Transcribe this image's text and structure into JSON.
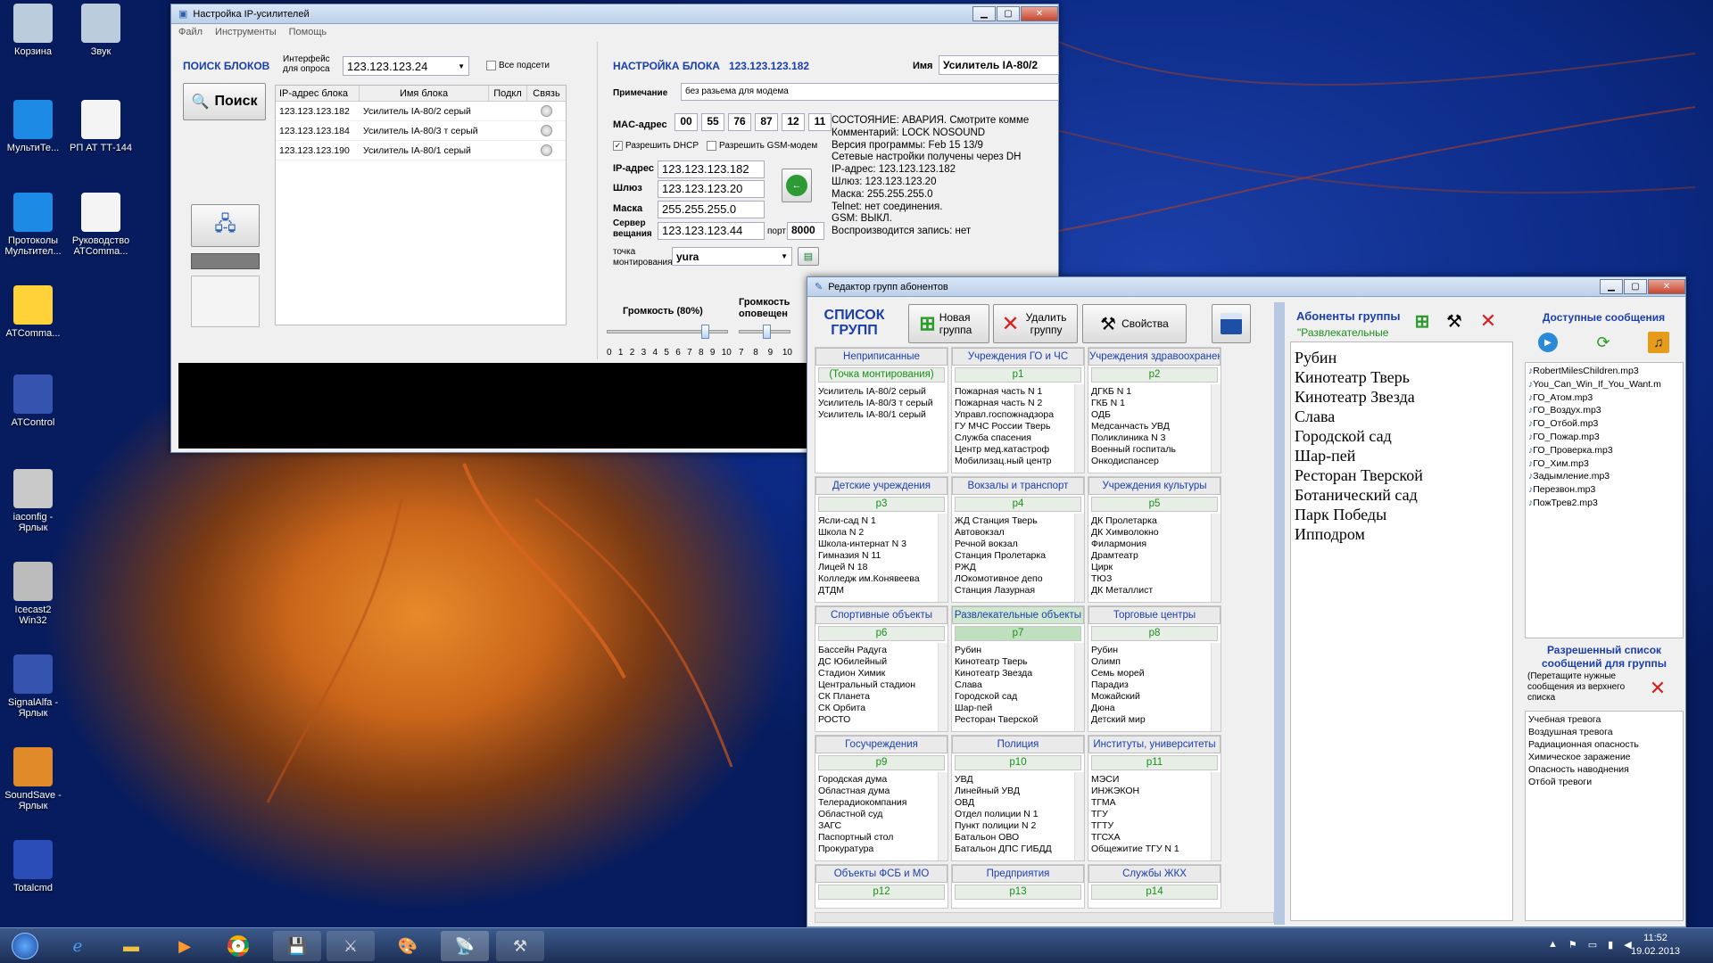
{
  "desktop": {
    "icons": [
      {
        "label": "Корзина",
        "name": "recycle-bin-icon"
      },
      {
        "label": "Звук",
        "name": "speaker-icon"
      },
      {
        "label": "МультиТе...",
        "name": "multite-app-icon"
      },
      {
        "label": "РП АТ ТТ-144",
        "name": "document-icon"
      },
      {
        "label": "Протоколы Мультител...",
        "name": "protocols-app-icon"
      },
      {
        "label": "Руководство ATComma...",
        "name": "document-icon"
      },
      {
        "label": "ATComma...",
        "name": "atcommander-icon"
      },
      {
        "label": "ATControl",
        "name": "atcontrol-icon"
      },
      {
        "label": "iaconfig - Ярлык",
        "name": "tools-icon"
      },
      {
        "label": "Icecast2 Win32",
        "name": "icecast-icon"
      },
      {
        "label": "SignalAlfa - Ярлык",
        "name": "signalalfa-icon"
      },
      {
        "label": "SoundSave - Ярлык",
        "name": "soundsave-icon"
      },
      {
        "label": "Totalcmd",
        "name": "totalcmd-icon"
      }
    ]
  },
  "amp_window": {
    "title": "Настройка IP-усилителей",
    "menu": [
      "Файл",
      "Инструменты",
      "Помощь"
    ],
    "search_heading": "ПОИСК БЛОКОВ",
    "iface_label": "Интерфейс для опроса",
    "iface_value": "123.123.123.24",
    "all_subnets": "Все подсети",
    "search_button": "Поиск",
    "table_headers": [
      "IP-адрес блока",
      "Имя блока",
      "Подкл",
      "Связь"
    ],
    "table_rows": [
      {
        "ip": "123.123.123.182",
        "name": "Усилитель IA-80/2 серый"
      },
      {
        "ip": "123.123.123.184",
        "name": "Усилитель IA-80/3 т серый"
      },
      {
        "ip": "123.123.123.190",
        "name": "Усилитель IA-80/1 серый"
      }
    ],
    "setup_heading": "НАСТРОЙКА БЛОКА",
    "setup_ip": "123.123.123.182",
    "name_label": "Имя",
    "name_value": "Усилитель IA-80/2",
    "note_label": "Примечание",
    "note_value": "без разьема для модема",
    "mac_label": "MAC-адрес",
    "mac": [
      "00",
      "55",
      "76",
      "87",
      "12",
      "11"
    ],
    "dhcp": "Разрешить DHCP",
    "gsm": "Разрешить GSM-модем",
    "ip_label": "IP-адрес",
    "ip_value": "123.123.123.182",
    "gw_label": "Шлюз",
    "gw_value": "123.123.123.20",
    "mask_label": "Маска",
    "mask_value": "255.255.255.0",
    "srv_label": "Сервер вещания",
    "srv_value": "123.123.123.44",
    "port_label": "порт",
    "port_value": "8000",
    "mount_label": "точка монтирования",
    "mount_value": "yura",
    "status_lines": [
      "СОСТОЯНИЕ: АВАРИЯ. Смотрите комме",
      "Комментарий: LOCK NOSOUND",
      "Версия программы: Feb 15 13/9",
      "Сетевые настройки получены через DH",
      "IP-адрес: 123.123.123.182",
      "Шлюз:     123.123.123.20",
      "Маска:     255.255.255.0",
      "Telnet:     нет соединения.",
      "GSM: ВЫКЛ.",
      "Воспроизводится запись: нет"
    ],
    "volume_label": "Громкость (80%)",
    "volume2_label": "Громкость оповещен",
    "volume_level": 0.8,
    "scale": [
      "0",
      "1",
      "2",
      "3",
      "4",
      "5",
      "6",
      "7",
      "8",
      "9",
      "10"
    ],
    "scale2": [
      "7",
      "8",
      "9",
      "10"
    ]
  },
  "group_window": {
    "title": "Редактор групп абонентов",
    "list_title": "СПИСОК ГРУПП",
    "new_group": "Новая группа",
    "delete_group": "Удалить группу",
    "properties": "Свойства",
    "groups": [
      {
        "name": "Неприписанные",
        "p": "(Точка монтирования)",
        "items": [
          "Усилитель IA-80/2 серый",
          "Усилитель IA-80/3 т серый",
          "Усилитель IA-80/1 серый"
        ]
      },
      {
        "name": "Учреждения ГО и ЧС",
        "p": "p1",
        "items": [
          "Пожарная часть N 1",
          "Пожарная часть N 2",
          "Управл.госпожнадзора",
          "ГУ МЧС России Тверь",
          "Служба спасения",
          "Центр мед.катастроф",
          "Мобилизац.ный центр"
        ]
      },
      {
        "name": "Учреждения здравоохранения",
        "p": "p2",
        "items": [
          "ДГКБ N 1",
          "ГКБ N 1",
          "ОДБ",
          "Медсанчасть УВД",
          "Поликлиника N 3",
          "Военный госпиталь",
          "Онкодиспансер"
        ]
      },
      {
        "name": "Детские учреждения",
        "p": "p3",
        "items": [
          "Ясли-сад N 1",
          "Школа N 2",
          "Школа-интернат N 3",
          "Гимназия N 11",
          "Лицей N 18",
          "Колледж им.Конявеева",
          "ДТДМ"
        ]
      },
      {
        "name": "Вокзалы и транспорт",
        "p": "p4",
        "items": [
          "ЖД Станция Тверь",
          "Автовокзал",
          "Речной вокзал",
          "Станция Пролетарка",
          "РЖД",
          "ЛОкомотивное депо",
          "Станция Лазурная"
        ]
      },
      {
        "name": "Учреждения культуры",
        "p": "p5",
        "items": [
          "ДК Пролетарка",
          "ДК Химволокно",
          "Филармония",
          "Драмтеатр",
          "Цирк",
          "ТЮЗ",
          "ДК Металлист"
        ]
      },
      {
        "name": "Спортивные объекты",
        "p": "p6",
        "items": [
          "Бассейн Радуга",
          "ДС Юбилейный",
          "Стадион Химик",
          "Центральный стадион",
          "СК Планета",
          "СК Орбита",
          "РОСТО"
        ]
      },
      {
        "name": "Развлекательные объекты",
        "p": "p7",
        "items": [
          "Рубин",
          "Кинотеатр Тверь",
          "Кинотеатр Звезда",
          "Слава",
          "Городской сад",
          "Шар-пей",
          "Ресторан Тверской"
        ]
      },
      {
        "name": "Торговые центры",
        "p": "p8",
        "items": [
          "Рубин",
          "Олимп",
          "Семь морей",
          "Парадиз",
          "Можайский",
          "Дюна",
          "Детский мир"
        ]
      },
      {
        "name": "Госучреждения",
        "p": "p9",
        "items": [
          "Городская дума",
          "Областная дума",
          "Телерадиокомпания",
          "Областной суд",
          "ЗАГС",
          "Паспортный стол",
          "Прокуратура"
        ]
      },
      {
        "name": "Полиция",
        "p": "p10",
        "items": [
          "УВД",
          "Линейный УВД",
          "ОВД",
          "Отдел полиции N 1",
          "Пункт полиции N 2",
          "Батальон ОВО",
          "Батальон ДПС ГИБДД"
        ]
      },
      {
        "name": "Институты, университеты",
        "p": "p11",
        "items": [
          "МЭСИ",
          "ИНЖЭКОН",
          "ТГМА",
          "ТГУ",
          "ТГТУ",
          "ТГСХА",
          "Общежитие ТГУ N 1"
        ]
      },
      {
        "name": "Объекты ФСБ и МО",
        "p": "p12",
        "items": []
      },
      {
        "name": "Предприятия",
        "p": "p13",
        "items": []
      },
      {
        "name": "Службы ЖКХ",
        "p": "p14",
        "items": []
      }
    ],
    "subs_title": "Абоненты группы",
    "subs_group": "\"Развлекательные",
    "subscribers": [
      "Рубин",
      "Кинотеатр Тверь",
      "Кинотеатр Звезда",
      "Слава",
      "Городской сад",
      "Шар-пей",
      "Ресторан Тверской",
      "Ботанический сад",
      "Парк Победы",
      "Ипподром"
    ],
    "avail_title": "Доступные сообщения",
    "messages": [
      "RobertMilesChildren.mp3",
      "You_Can_Win_If_You_Want.m",
      "ГО_Атом.mp3",
      "ГО_Воздух.mp3",
      "ГО_Отбой.mp3",
      "ГО_Пожар.mp3",
      "ГО_Проверка.mp3",
      "ГО_Хим.mp3",
      "Задымление.mp3",
      "Перезвон.mp3",
      "ПожТрев2.mp3"
    ],
    "allowed_title": "Разрешенный список сообщений для группы",
    "allowed_hint": "(Перетащите нужные сообщения из верхнего списка",
    "allowed": [
      "Учебная тревога",
      "Воздушная тревога",
      "Радиационная опасность",
      "Химическое заражение",
      "Опасность наводнения",
      "Отбой тревоги"
    ]
  },
  "taskbar": {
    "time": "11:52",
    "date": "19.02.2013"
  },
  "colors": {
    "accent": "#1b3eae",
    "green": "#1a8f1a",
    "selected_group": "#cfe8cf"
  }
}
